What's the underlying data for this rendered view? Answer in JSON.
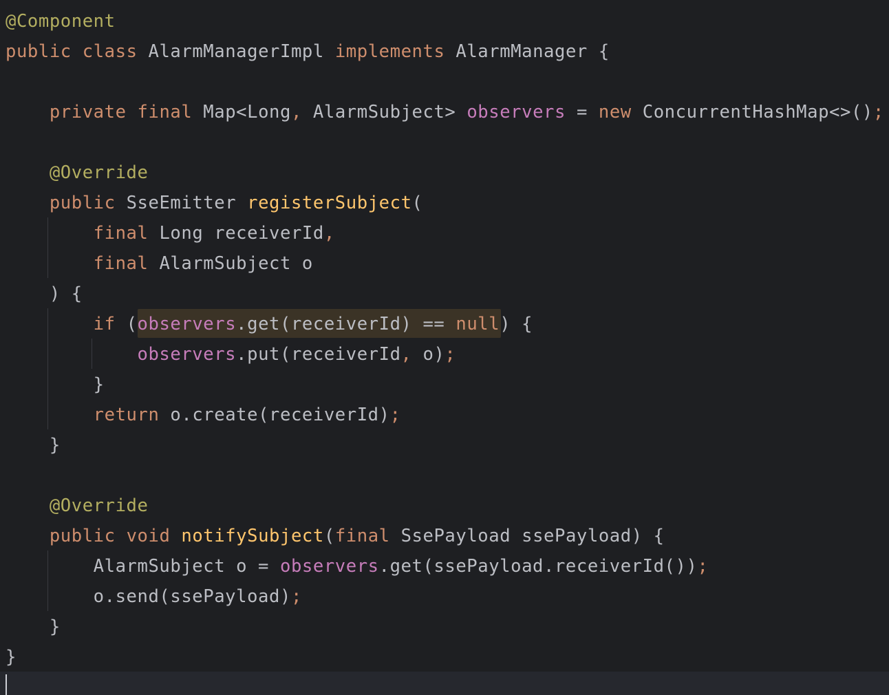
{
  "editor": {
    "language": "java",
    "theme": "dark",
    "colors": {
      "background": "#1e1f22",
      "keyword": "#cf8e6d",
      "annotation": "#b3ae60",
      "method_declaration": "#ffc66d",
      "field": "#c77dbb",
      "text": "#bcbec4"
    },
    "lines": {
      "l1": {
        "ann": "@Component"
      },
      "l2": {
        "kw1": "public",
        "kw2": "class",
        "name": "AlarmManagerImpl",
        "kw3": "implements",
        "iface": "AlarmManager",
        "brace": "{"
      },
      "l4": {
        "kw1": "private",
        "kw2": "final",
        "type1": "Map<Long",
        "comma": ",",
        "type2": "AlarmSubject>",
        "field": "observers",
        "eq": "=",
        "kw3": "new",
        "ctor": "ConcurrentHashMap<>()",
        "semi": ";"
      },
      "l6": {
        "ann": "@Override"
      },
      "l7": {
        "kw": "public",
        "type": "SseEmitter",
        "method": "registerSubject",
        "paren": "("
      },
      "l8": {
        "kw": "final",
        "type": "Long",
        "param": "receiverId",
        "comma": ","
      },
      "l9": {
        "kw": "final",
        "type": "AlarmSubject",
        "param": "o"
      },
      "l10": {
        "text": ") {"
      },
      "l11": {
        "kw": "if",
        "open": "(",
        "field": "observers",
        "call": ".get(receiverId) ==",
        "nullkw": "null",
        "close": ") {"
      },
      "l12": {
        "field": "observers",
        "call": ".put(receiverId",
        "comma": ",",
        "rest": "o)",
        "semi": ";"
      },
      "l13": {
        "text": "}"
      },
      "l14": {
        "kw": "return",
        "rest": "o.create(receiverId)",
        "semi": ";"
      },
      "l15": {
        "text": "}"
      },
      "l17": {
        "ann": "@Override"
      },
      "l18": {
        "kw1": "public",
        "kw2": "void",
        "method": "notifySubject",
        "open": "(",
        "kw3": "final",
        "rest": "SsePayload ssePayload) {"
      },
      "l19": {
        "type": "AlarmSubject o =",
        "field": "observers",
        "rest": ".get(ssePayload.receiverId())",
        "semi": ";"
      },
      "l20": {
        "rest": "o.send(ssePayload)",
        "semi": ";"
      },
      "l21": {
        "text": "}"
      },
      "l22": {
        "text": "}"
      }
    }
  }
}
